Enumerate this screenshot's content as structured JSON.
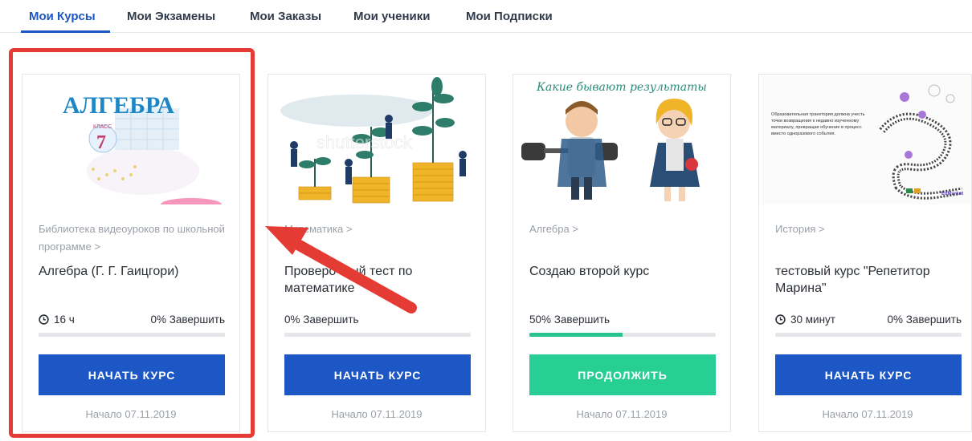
{
  "tabs": [
    {
      "label": "Мои Курсы",
      "active": true
    },
    {
      "label": "Мои Экзамены",
      "active": false
    },
    {
      "label": "Мои Заказы",
      "active": false
    },
    {
      "label": "Мои ученики",
      "active": false
    },
    {
      "label": "Мои Подписки",
      "active": false
    }
  ],
  "cards": [
    {
      "thumbnail_text": "АЛГЕБРА",
      "thumbnail_subtext": "КЛАСС",
      "thumbnail_grade": "7",
      "category": "Библиотека видеоуроков по школьной программе >",
      "title": "Алгебра (Г. Г. Гаицгори)",
      "duration": "16 ч",
      "progress_label": "0% Завершить",
      "progress_fraction": 0,
      "button_label": "НАЧАТЬ КУРС",
      "button_color": "#1d56c5",
      "start_date": "Начало 07.11.2019"
    },
    {
      "thumbnail_text": "shutterstock",
      "category": "Математика >",
      "title": "Проверочный тест по математике",
      "duration": "",
      "progress_label": "0% Завершить",
      "progress_fraction": 0,
      "button_label": "НАЧАТЬ КУРС",
      "button_color": "#1d56c5",
      "start_date": "Начало 07.11.2019"
    },
    {
      "thumbnail_text": "Какие бывают результаты",
      "category": "Алгебра >",
      "title": "Создаю второй курс",
      "duration": "",
      "progress_label": "50% Завершить",
      "progress_fraction": 0.5,
      "button_label": "ПРОДОЛЖИТЬ",
      "button_color": "#27cf95",
      "start_date": "Начало 07.11.2019"
    },
    {
      "thumbnail_text": "Образовательная траектория должна учесть точки возвращения к недавно изученному материалу, превращая обучение в процесс вместо одноразового события.",
      "thumbnail_brand": "EdMarket",
      "category": "История >",
      "title": "тестовый курс \"Репетитор Марина\"",
      "duration": "30 минут",
      "progress_label": "0% Завершить",
      "progress_fraction": 0,
      "button_label": "НАЧАТЬ КУРС",
      "button_color": "#1d56c5",
      "start_date": "Начало 07.11.2019"
    }
  ],
  "annotation": {
    "color": "#e53b35",
    "shape": "red highlight box with arrow pointing at first card"
  }
}
